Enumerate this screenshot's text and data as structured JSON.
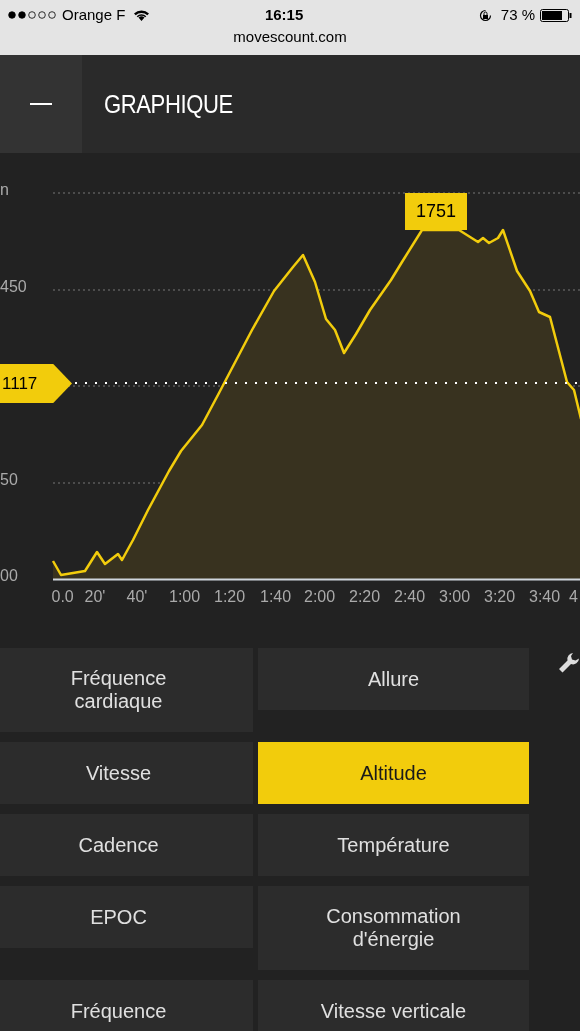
{
  "status_bar": {
    "carrier": "Orange F",
    "time": "16:15",
    "battery": "73 %"
  },
  "address": "movescount.com",
  "header": {
    "title": "GRAPHIQUE"
  },
  "chart": {
    "y_labels": [
      "n",
      "450",
      "50",
      "00"
    ],
    "x_labels": [
      "0.0",
      "20'",
      "40'",
      "1:00",
      "1:20",
      "1:40",
      "2:00",
      "2:20",
      "2:40",
      "3:00",
      "3:20",
      "3:40",
      "4"
    ],
    "cursor_label": "1117",
    "peak_label": "1751"
  },
  "metrics": [
    {
      "label": "Fréquence cardiaque",
      "selected": false
    },
    {
      "label": "Allure",
      "selected": false
    },
    {
      "label": "Vitesse",
      "selected": false
    },
    {
      "label": "Altitude",
      "selected": true
    },
    {
      "label": "Cadence",
      "selected": false
    },
    {
      "label": "Température",
      "selected": false
    },
    {
      "label": "EPOC",
      "selected": false
    },
    {
      "label": "Consommation d'énergie",
      "selected": false
    },
    {
      "label": "Fréquence",
      "selected": false
    },
    {
      "label": "Vitesse verticale",
      "selected": false
    }
  ]
}
